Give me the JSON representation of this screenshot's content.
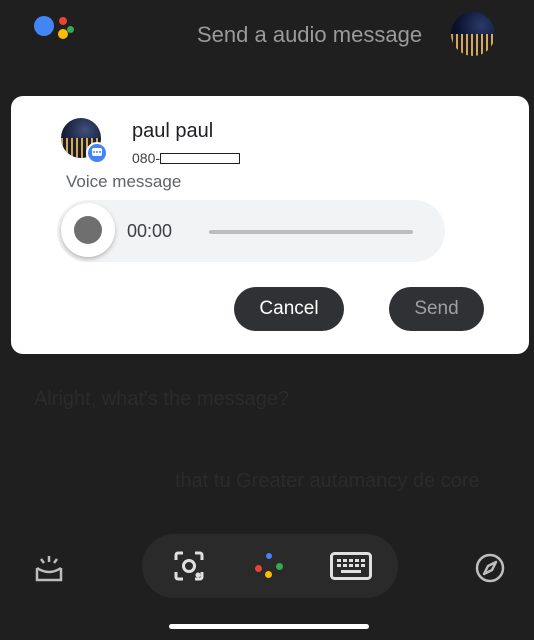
{
  "header": {
    "prompt": "Send a audio message"
  },
  "card": {
    "contact_name": "paul paul",
    "contact_number_prefix": "080-",
    "voice_label": "Voice message",
    "timer": "00:00",
    "cancel_label": "Cancel",
    "send_label": "Send"
  },
  "transcript": {
    "question": "Alright, what's the message?",
    "answer": "that tu Greater autamancy de core"
  },
  "bottom_bar": {
    "icons": [
      "tray-icon",
      "lens-icon",
      "assistant-icon",
      "keyboard-icon",
      "compass-icon"
    ]
  },
  "colors": {
    "background": "#1f1f1f",
    "card": "#ffffff",
    "button": "#303134",
    "google_blue": "#4285f4",
    "google_red": "#ea4335",
    "google_yellow": "#fbbc04",
    "google_green": "#34a853"
  }
}
